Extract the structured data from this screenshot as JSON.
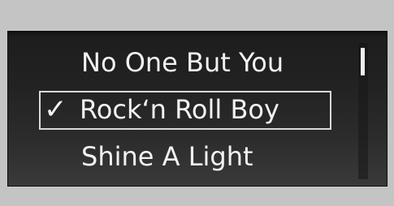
{
  "song_list": {
    "items": [
      {
        "label": "No One But You",
        "selected": false
      },
      {
        "label": "Rock‘n Roll Boy",
        "selected": true,
        "check_mark": "✓"
      },
      {
        "label": "Shine A Light",
        "selected": false
      }
    ]
  },
  "scrollbar": {
    "position": 0
  },
  "colors": {
    "background": "#c4c4c4",
    "screen": "#222222",
    "text": "#f2f2f2",
    "selection_border": "#d9d9d9",
    "scroll_thumb": "#ededed"
  }
}
